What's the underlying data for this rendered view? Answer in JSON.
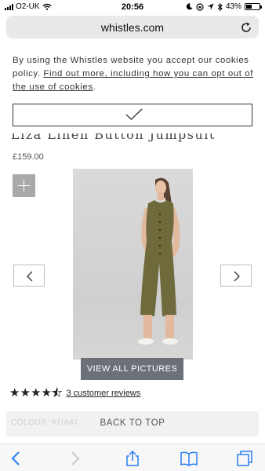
{
  "status_bar": {
    "carrier": "O2-UK",
    "time": "20:56",
    "battery": "43%",
    "battery_level": 0.43
  },
  "browser": {
    "url": "whistles.com"
  },
  "cookie_banner": {
    "text": "By using the Whistles website you accept our cookies policy. ",
    "link_text": "Find out more, including how you can opt out of the use of cookies",
    "text_end": "."
  },
  "product": {
    "title": "Liza Linen Button Jumpsuit",
    "price": "£159.00",
    "view_all_label": "VIEW ALL PICTURES",
    "rating": 4.5,
    "reviews_label": "3 customer reviews"
  },
  "bottom": {
    "colour_label": "COLOUR: KHAKI",
    "back_to_top_label": "BACK TO TOP"
  },
  "colors": {
    "garment": "#6e6a3c",
    "button_grey": "#6b7177",
    "zoom_grey": "#a9a9a9"
  }
}
